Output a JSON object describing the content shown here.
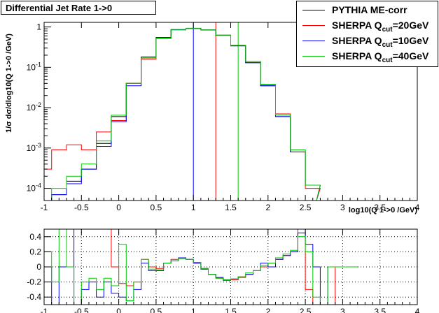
{
  "title": "Differential Jet Rate 1->0",
  "legend": [
    {
      "label_pre": "PYTHIA ME-corr",
      "sub": "",
      "label_post": "",
      "color": "#000000"
    },
    {
      "label_pre": "SHERPA Q",
      "sub": "cut",
      "label_post": "=20GeV",
      "color": "#ff0000"
    },
    {
      "label_pre": "SHERPA Q",
      "sub": "cut",
      "label_post": "=10GeV",
      "color": "#0000ff"
    },
    {
      "label_pre": "SHERPA Q",
      "sub": "cut",
      "label_post": "=40GeV",
      "color": "#00cc00"
    }
  ],
  "chart_data": [
    {
      "type": "line",
      "title": "Differential Jet Rate 1->0",
      "xlabel": "log10(Q 1->0 /GeV)",
      "ylabel": "1/σ dσ/dlog10(Q 1->0 /GeV)",
      "xlim": [
        -1,
        4
      ],
      "ylim": [
        5e-05,
        1.3
      ],
      "yscale": "log",
      "x_ticks": [
        "-1",
        "-0.5",
        "0",
        "0.5",
        "1",
        "1.5",
        "2",
        "2.5",
        "3",
        "3.5",
        "4"
      ],
      "y_ticks": [
        "10^-4",
        "10^-3",
        "10^-2",
        "10^-1",
        "1"
      ],
      "vlines": [
        {
          "x": 1.0,
          "color": "#0000ff"
        },
        {
          "x": 1.3,
          "color": "#ff0000"
        },
        {
          "x": 1.6,
          "color": "#00cc00"
        }
      ],
      "x": [
        -1.0,
        -0.8,
        -0.6,
        -0.4,
        -0.2,
        0.0,
        0.2,
        0.4,
        0.6,
        0.8,
        1.0,
        1.2,
        1.4,
        1.6,
        1.8,
        2.0,
        2.2,
        2.4,
        2.6,
        2.75
      ],
      "series": [
        {
          "name": "PYTHIA ME-corr",
          "color": "#000000",
          "values": [
            3e-05,
            7e-05,
            0.00015,
            0.0003,
            0.0013,
            0.006,
            0.04,
            0.18,
            0.55,
            0.86,
            0.92,
            0.84,
            0.62,
            0.34,
            0.13,
            0.035,
            0.006,
            0.0008,
            0.00012,
            3e-05
          ]
        },
        {
          "name": "SHERPA Qcut=20GeV",
          "color": "#ff0000",
          "values": [
            0.0003,
            0.0009,
            0.0012,
            0.0009,
            0.0025,
            0.0048,
            0.04,
            0.16,
            0.52,
            0.85,
            0.93,
            0.85,
            0.62,
            0.35,
            0.14,
            0.037,
            0.007,
            0.0009,
            0.0001,
            3e-05
          ]
        },
        {
          "name": "SHERPA Qcut=10GeV",
          "color": "#0000ff",
          "values": [
            3e-05,
            7e-05,
            0.00013,
            0.0003,
            0.0011,
            0.0045,
            0.035,
            0.17,
            0.55,
            0.86,
            0.92,
            0.85,
            0.63,
            0.34,
            0.13,
            0.035,
            0.006,
            0.0008,
            0.00012,
            3e-05
          ]
        },
        {
          "name": "SHERPA Qcut=40GeV",
          "color": "#00cc00",
          "values": [
            3e-05,
            0.0001,
            0.0002,
            0.0004,
            0.0015,
            0.0065,
            0.04,
            0.17,
            0.53,
            0.85,
            0.92,
            0.85,
            0.63,
            0.35,
            0.14,
            0.038,
            0.0065,
            0.0009,
            0.00012,
            3e-05
          ]
        }
      ]
    },
    {
      "type": "line",
      "title": "",
      "xlabel": "",
      "ylabel": "",
      "xlim": [
        -1,
        4
      ],
      "ylim": [
        -0.5,
        0.5
      ],
      "x_ticks": [
        "-1",
        "-0.5",
        "0",
        "0.5",
        "1",
        "1.5",
        "2",
        "2.5",
        "3",
        "3.5",
        "4"
      ],
      "y_ticks": [
        "-0.4",
        "-0.2",
        "0",
        "0.2",
        "0.4"
      ],
      "grid": true,
      "x": [
        -0.95,
        -0.85,
        -0.75,
        -0.65,
        -0.55,
        -0.45,
        -0.35,
        -0.25,
        -0.15,
        -0.05,
        0.05,
        0.15,
        0.25,
        0.35,
        0.45,
        0.55,
        0.65,
        0.75,
        0.85,
        0.95,
        1.05,
        1.15,
        1.25,
        1.35,
        1.45,
        1.55,
        1.65,
        1.75,
        1.85,
        1.95,
        2.05,
        2.15,
        2.25,
        2.35,
        2.45,
        2.55,
        2.65,
        2.75,
        2.85,
        2.95,
        3.05,
        3.15
      ],
      "series": [
        {
          "name": "SHERPA Qcut=20GeV",
          "color": "#ff0000",
          "values": [
            0.5,
            0.5,
            0.5,
            0.5,
            0.5,
            0.5,
            0.5,
            0.5,
            0.5,
            0.0,
            -0.22,
            -0.25,
            -0.2,
            0.1,
            0.0,
            -0.02,
            0.05,
            0.1,
            0.12,
            0.1,
            0.05,
            -0.02,
            -0.1,
            -0.15,
            -0.18,
            -0.17,
            -0.14,
            -0.1,
            -0.05,
            0.0,
            0.05,
            0.1,
            0.15,
            0.2,
            0.5,
            -0.3,
            -0.5,
            -0.5,
            -0.5,
            0.0,
            0.0,
            0.0
          ]
        },
        {
          "name": "SHERPA Qcut=10GeV",
          "color": "#0000ff",
          "values": [
            0.0,
            -0.5,
            0.0,
            0.5,
            -0.5,
            -0.3,
            -0.2,
            -0.4,
            -0.2,
            -0.35,
            -0.4,
            -0.45,
            -0.3,
            0.05,
            -0.05,
            -0.05,
            0.05,
            0.08,
            0.12,
            0.1,
            0.05,
            -0.03,
            -0.1,
            -0.14,
            -0.17,
            -0.16,
            -0.13,
            -0.1,
            -0.05,
            0.05,
            0.0,
            0.1,
            0.15,
            0.2,
            0.45,
            0.3,
            0.0,
            -0.5,
            0.0,
            0.0,
            0.0,
            0.0
          ]
        },
        {
          "name": "SHERPA Qcut=40GeV",
          "color": "#00cc00",
          "values": [
            0.2,
            -0.2,
            0.5,
            0.0,
            -0.5,
            -0.2,
            -0.15,
            -0.3,
            -0.15,
            -0.25,
            0.3,
            -0.45,
            -0.2,
            0.1,
            -0.03,
            -0.04,
            0.05,
            0.08,
            0.11,
            0.1,
            0.06,
            -0.02,
            -0.1,
            -0.15,
            -0.17,
            -0.16,
            -0.13,
            -0.08,
            -0.05,
            0.02,
            0.05,
            0.12,
            0.17,
            0.22,
            0.4,
            0.2,
            -0.4,
            -0.5,
            0.0,
            0.0,
            0.0,
            0.0
          ]
        }
      ]
    }
  ]
}
